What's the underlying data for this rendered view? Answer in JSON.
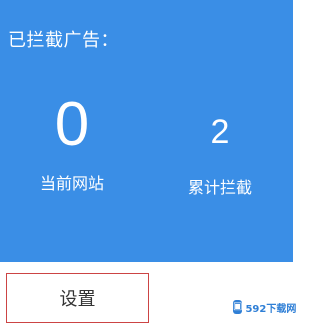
{
  "colors": {
    "panel": "#3a8ee6",
    "panel_text": "#ffffff",
    "button_border": "#cc4444",
    "watermark": "#2f7fd6"
  },
  "panel": {
    "title": "已拦截广告：",
    "current_site": {
      "value": "0",
      "label": "当前网站"
    },
    "total": {
      "value": "2",
      "label": "累计拦截"
    }
  },
  "settings_button": {
    "label": "设置"
  },
  "watermark": {
    "icon": "brand-logo-icon",
    "text": "592下载网"
  }
}
